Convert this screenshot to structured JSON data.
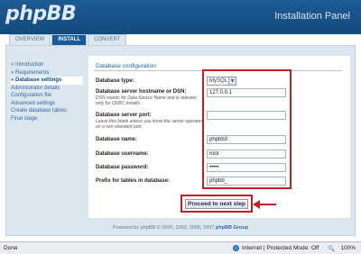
{
  "header": {
    "logo": "phpBB",
    "panel_title": "Installation Panel"
  },
  "tabs": [
    {
      "label": "OVERVIEW"
    },
    {
      "label": "INSTALL"
    },
    {
      "label": "CONVERT"
    }
  ],
  "sidebar": {
    "items": [
      {
        "label": "» Introduction"
      },
      {
        "label": "» Requirements"
      },
      {
        "label": "» Database settings"
      },
      {
        "label": "Administrator details"
      },
      {
        "label": "Configuration file"
      },
      {
        "label": "Advanced settings"
      },
      {
        "label": "Create database tables"
      },
      {
        "label": "Final stage"
      }
    ]
  },
  "form": {
    "legend": "Database configuration",
    "db_type_label": "Database type:",
    "db_type_value": "MySQL",
    "host_label": "Database server hostname or DSN:",
    "host_hint": "DSN stands for Data Source Name and is relevant only for ODBC installs.",
    "host_value": "127.0.0.1",
    "port_label": "Database server port:",
    "port_hint": "Leave this blank unless you know the server operates on a non-standard port.",
    "port_value": "",
    "name_label": "Database name:",
    "name_value": "phpbb3",
    "user_label": "Database username:",
    "user_value": "root",
    "pass_label": "Database password:",
    "pass_value": "•••••",
    "prefix_label": "Prefix for tables in database:",
    "prefix_value": "phpbb_",
    "submit_label": "Proceed to next step"
  },
  "footer": {
    "text": "Powered by phpBB © 2000, 2002, 2005, 2007",
    "group": "phpBB Group"
  },
  "statusbar": {
    "done": "Done",
    "zone": "Internet | Protected Mode: Off",
    "zoom": "100%"
  },
  "colors": {
    "header": "#1d5b94",
    "highlight": "#c01f25",
    "link": "#2d6aa3"
  }
}
